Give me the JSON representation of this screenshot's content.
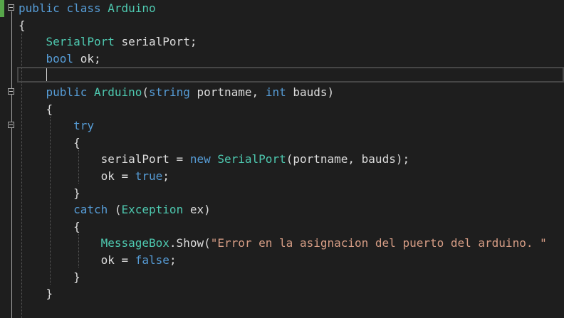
{
  "editor": {
    "lines": [
      [
        {
          "t": "public",
          "c": "kw"
        },
        {
          "t": " ",
          "c": "tx"
        },
        {
          "t": "class",
          "c": "kw"
        },
        {
          "t": " ",
          "c": "tx"
        },
        {
          "t": "Arduino",
          "c": "ty"
        }
      ],
      [
        {
          "t": "{",
          "c": "tx"
        }
      ],
      [
        {
          "t": "    ",
          "c": "tx"
        },
        {
          "t": "SerialPort",
          "c": "ty"
        },
        {
          "t": " serialPort;",
          "c": "tx"
        }
      ],
      [
        {
          "t": "    ",
          "c": "tx"
        },
        {
          "t": "bool",
          "c": "kw"
        },
        {
          "t": " ok;",
          "c": "tx"
        }
      ],
      [
        {
          "t": "",
          "c": "tx"
        }
      ],
      [
        {
          "t": "    ",
          "c": "tx"
        },
        {
          "t": "public",
          "c": "kw"
        },
        {
          "t": " ",
          "c": "tx"
        },
        {
          "t": "Arduino",
          "c": "ty"
        },
        {
          "t": "(",
          "c": "tx"
        },
        {
          "t": "string",
          "c": "kw"
        },
        {
          "t": " portname, ",
          "c": "tx"
        },
        {
          "t": "int",
          "c": "kw"
        },
        {
          "t": " bauds)",
          "c": "tx"
        }
      ],
      [
        {
          "t": "    {",
          "c": "tx"
        }
      ],
      [
        {
          "t": "        ",
          "c": "tx"
        },
        {
          "t": "try",
          "c": "kw"
        }
      ],
      [
        {
          "t": "        {",
          "c": "tx"
        }
      ],
      [
        {
          "t": "            serialPort = ",
          "c": "tx"
        },
        {
          "t": "new",
          "c": "kw"
        },
        {
          "t": " ",
          "c": "tx"
        },
        {
          "t": "SerialPort",
          "c": "ty"
        },
        {
          "t": "(portname, bauds);",
          "c": "tx"
        }
      ],
      [
        {
          "t": "            ok = ",
          "c": "tx"
        },
        {
          "t": "true",
          "c": "kw"
        },
        {
          "t": ";",
          "c": "tx"
        }
      ],
      [
        {
          "t": "        }",
          "c": "tx"
        }
      ],
      [
        {
          "t": "        ",
          "c": "tx"
        },
        {
          "t": "catch",
          "c": "kw"
        },
        {
          "t": " (",
          "c": "tx"
        },
        {
          "t": "Exception",
          "c": "ty"
        },
        {
          "t": " ex)",
          "c": "tx"
        }
      ],
      [
        {
          "t": "        {",
          "c": "tx"
        }
      ],
      [
        {
          "t": "            ",
          "c": "tx"
        },
        {
          "t": "MessageBox",
          "c": "ty"
        },
        {
          "t": ".Show(",
          "c": "tx"
        },
        {
          "t": "\"Error en la asignacion del puerto del arduino. \"",
          "c": "st"
        }
      ],
      [
        {
          "t": "            ok = ",
          "c": "tx"
        },
        {
          "t": "false",
          "c": "kw"
        },
        {
          "t": ";",
          "c": "tx"
        }
      ],
      [
        {
          "t": "        }",
          "c": "tx"
        }
      ],
      [
        {
          "t": "    }",
          "c": "tx"
        }
      ]
    ]
  },
  "colors": {
    "background": "#1e1e1e",
    "keyword": "#569cd6",
    "type": "#4ec9b0",
    "string": "#d69d85",
    "text": "#dcdcdc",
    "change_bar": "#57a64a"
  }
}
